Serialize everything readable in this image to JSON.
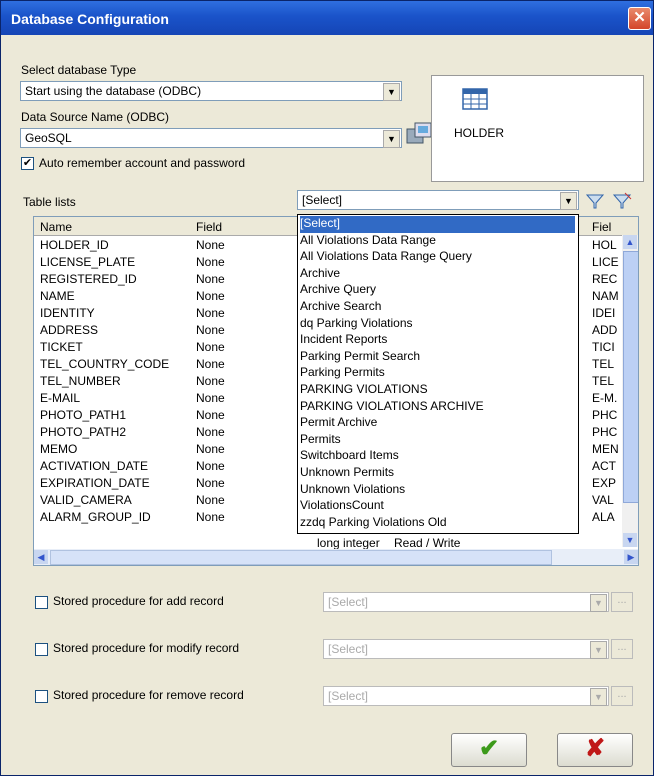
{
  "window": {
    "title": "Database Configuration"
  },
  "db_type": {
    "label": "Select database Type",
    "value": "Start using the database (ODBC)"
  },
  "dsn": {
    "label": "Data Source Name (ODBC)",
    "value": "GeoSQL"
  },
  "auto_remember": {
    "label": "Auto remember account and password",
    "checked": true
  },
  "holder_panel": {
    "label": "HOLDER"
  },
  "table_lists": {
    "label": "Table lists",
    "selected": "[Select]",
    "options": [
      "[Select]",
      "All Violations Data Range",
      "All Violations Data Range Query",
      "Archive",
      "Archive Query",
      "Archive Search",
      "dq Parking Violations",
      "Incident Reports",
      "Parking Permit Search",
      "Parking Permits",
      "PARKING VIOLATIONS",
      "PARKING VIOLATIONS ARCHIVE",
      "Permit Archive",
      "Permits",
      "Switchboard Items",
      "Unknown Permits",
      "Unknown Violations",
      "ViolationsCount",
      "zzdq Parking Violations Old"
    ]
  },
  "grid": {
    "columns": [
      "Name",
      "Field",
      "Fiel"
    ],
    "rows": [
      {
        "name": "HOLDER_ID",
        "field": "None",
        "right": "HOL"
      },
      {
        "name": "LICENSE_PLATE",
        "field": "None",
        "right": "LICE"
      },
      {
        "name": "REGISTERED_ID",
        "field": "None",
        "right": "REC"
      },
      {
        "name": "NAME",
        "field": "None",
        "right": "NAM"
      },
      {
        "name": "IDENTITY",
        "field": "None",
        "right": "IDEI"
      },
      {
        "name": "ADDRESS",
        "field": "None",
        "right": "ADD"
      },
      {
        "name": "TICKET",
        "field": "None",
        "right": "TICI"
      },
      {
        "name": "TEL_COUNTRY_CODE",
        "field": "None",
        "right": "TEL"
      },
      {
        "name": "TEL_NUMBER",
        "field": "None",
        "right": "TEL"
      },
      {
        "name": "E-MAIL",
        "field": "None",
        "right": "E-M."
      },
      {
        "name": "PHOTO_PATH1",
        "field": "None",
        "right": "PHC"
      },
      {
        "name": "PHOTO_PATH2",
        "field": "None",
        "right": "PHC"
      },
      {
        "name": "MEMO",
        "field": "None",
        "right": "MEN"
      },
      {
        "name": "ACTIVATION_DATE",
        "field": "None",
        "right": "ACT"
      },
      {
        "name": "EXPIRATION_DATE",
        "field": "None",
        "right": "EXP"
      },
      {
        "name": "VALID_CAMERA",
        "field": "None",
        "right": "VAL"
      },
      {
        "name": "ALARM_GROUP_ID",
        "field": "None",
        "right": "ALA"
      }
    ],
    "partial_row": {
      "type": "long integer",
      "access": "Read / Write"
    }
  },
  "stored_procs": [
    {
      "label": "Stored procedure for add record",
      "value": "[Select]",
      "ellipsis": "..."
    },
    {
      "label": "Stored procedure for modify record",
      "value": "[Select]",
      "ellipsis": "..."
    },
    {
      "label": "Stored procedure for remove record",
      "value": "[Select]",
      "ellipsis": "..."
    }
  ],
  "buttons": {
    "ok": "✔",
    "cancel": "✘"
  },
  "glyphs": {
    "close": "✕",
    "check": "✔",
    "down": "▼",
    "up": "▲",
    "left": "◀",
    "right": "▶"
  }
}
